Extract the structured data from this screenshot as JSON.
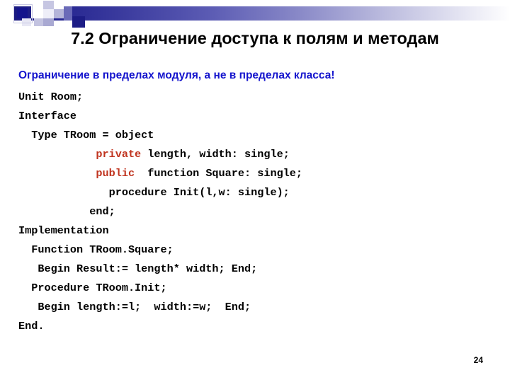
{
  "slide": {
    "title": "7.2 Ограничение доступа к полям и методам",
    "subtitle": "Ограничение в пределах модуля, а не в пределах класса!",
    "page_number": "24",
    "accent_colors": {
      "bar_dark": "#1a1a80",
      "bar_light": "#ffffff",
      "subtitle": "#1414cd",
      "keyword_red": "#c0341f",
      "text": "#000000",
      "background": "#ffffff"
    }
  },
  "code": {
    "lines": [
      {
        "indent": 0,
        "text": "Unit Room;"
      },
      {
        "indent": 0,
        "text": "Interface"
      },
      {
        "indent": 2,
        "text": "Type TRoom = object"
      },
      {
        "indent": 12,
        "keyword": "private",
        "text": " length, width: single;"
      },
      {
        "indent": 12,
        "keyword": "public",
        "text": "  function Square: single;"
      },
      {
        "indent": 14,
        "text": "procedure Init(l,w: single);"
      },
      {
        "indent": 11,
        "text": "end;"
      },
      {
        "indent": 0,
        "text": "Implementation"
      },
      {
        "indent": 2,
        "text": "Function TRoom.Square;"
      },
      {
        "indent": 2,
        "text": " Begin Result:= length* width; End;"
      },
      {
        "indent": 2,
        "text": "Procedure TRoom.Init;"
      },
      {
        "indent": 2,
        "text": " Begin length:=l;  width:=w;  End;"
      },
      {
        "indent": 0,
        "text": "End."
      }
    ]
  }
}
